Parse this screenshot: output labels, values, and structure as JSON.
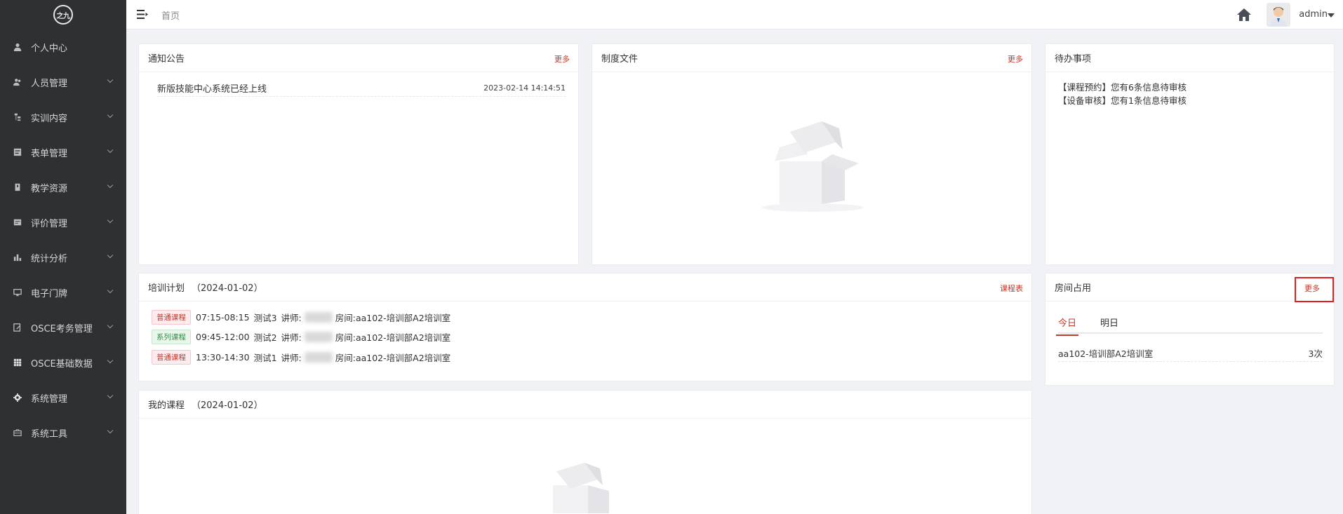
{
  "logo": {
    "text": "之九"
  },
  "sidebar": {
    "items": [
      {
        "label": "个人中心",
        "icon": "user-icon",
        "expandable": false
      },
      {
        "label": "人员管理",
        "icon": "users-icon",
        "expandable": true
      },
      {
        "label": "实训内容",
        "icon": "sitemap-icon",
        "expandable": true
      },
      {
        "label": "表单管理",
        "icon": "form-icon",
        "expandable": true
      },
      {
        "label": "教学资源",
        "icon": "book-icon",
        "expandable": true
      },
      {
        "label": "评价管理",
        "icon": "evaluation-icon",
        "expandable": true
      },
      {
        "label": "统计分析",
        "icon": "bar-chart-icon",
        "expandable": true
      },
      {
        "label": "电子门牌",
        "icon": "monitor-icon",
        "expandable": true
      },
      {
        "label": "OSCE考务管理",
        "icon": "edit-icon",
        "expandable": true
      },
      {
        "label": "OSCE基础数据",
        "icon": "grid-icon",
        "expandable": true
      },
      {
        "label": "系统管理",
        "icon": "gear-icon",
        "expandable": true
      },
      {
        "label": "系统工具",
        "icon": "toolbox-icon",
        "expandable": true
      }
    ]
  },
  "topbar": {
    "breadcrumb": "首页",
    "username": "admin"
  },
  "notice": {
    "title": "通知公告",
    "more": "更多",
    "items": [
      {
        "title": "新版技能中心系统已经上线",
        "date": "2023-02-14 14:14:51"
      }
    ]
  },
  "docs": {
    "title": "制度文件",
    "more": "更多"
  },
  "todo": {
    "title": "待办事项",
    "items": [
      "【课程预约】您有6条信息待审核",
      "【设备审核】您有1条信息待审核"
    ]
  },
  "plan": {
    "title": "培训计划",
    "date": "（2024-01-02）",
    "more": "课程表",
    "rows": [
      {
        "tag": "普通课程",
        "tagType": "red",
        "time": "07:15-08:15",
        "name": "测试3",
        "teacherLabel": "讲师:",
        "roomLabel": "房间:",
        "room": "aa102-培训部A2培训室"
      },
      {
        "tag": "系列课程",
        "tagType": "green",
        "time": "09:45-12:00",
        "name": "测试2",
        "teacherLabel": "讲师:",
        "roomLabel": "房间:",
        "room": "aa102-培训部A2培训室"
      },
      {
        "tag": "普通课程",
        "tagType": "red",
        "time": "13:30-14:30",
        "name": "测试1",
        "teacherLabel": "讲师:",
        "roomLabel": "房间:",
        "room": "aa102-培训部A2培训室"
      }
    ]
  },
  "rooms": {
    "title": "房间占用",
    "more": "更多",
    "tabs": [
      "今日",
      "明日"
    ],
    "activeTab": 0,
    "rows": [
      {
        "name": "aa102-培训部A2培训室",
        "count": "3次"
      }
    ]
  },
  "mycourse": {
    "title": "我的课程",
    "date": "（2024-01-02）"
  },
  "colors": {
    "sidebar": "#2f3032",
    "accent": "#c0392b",
    "highlight": "#e02020"
  }
}
